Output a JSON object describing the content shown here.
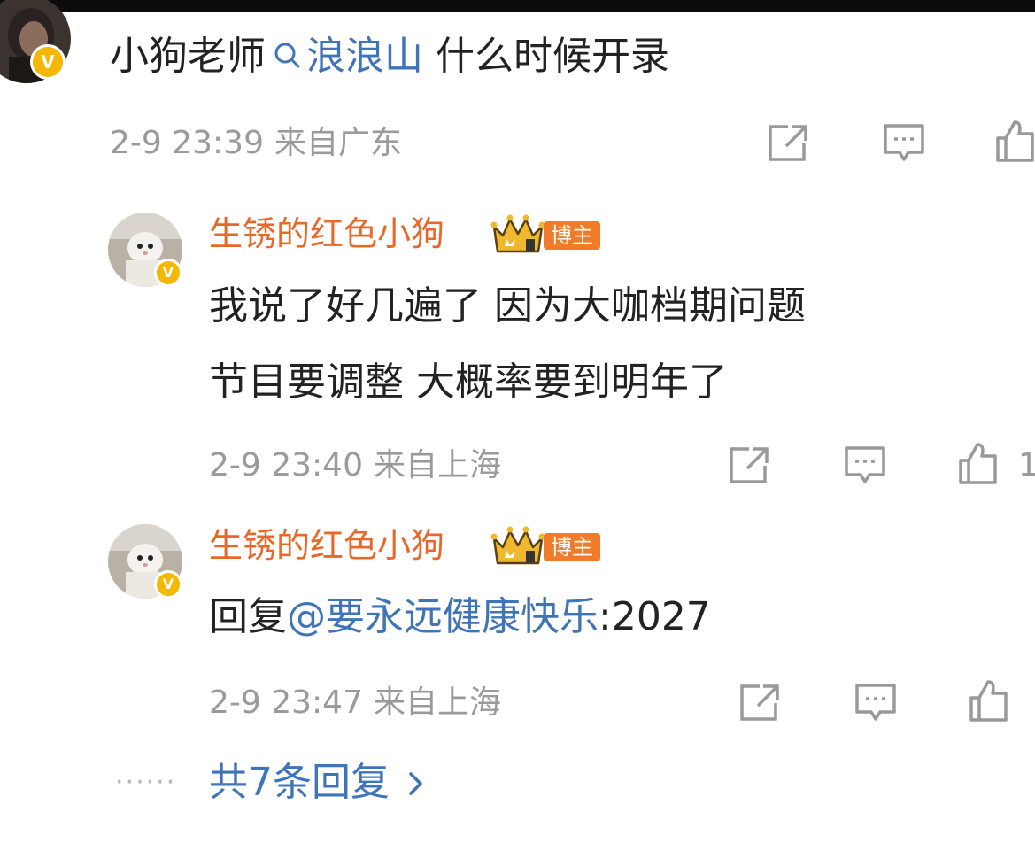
{
  "post": {
    "author_prefix": "小狗老师",
    "topic": "浪浪山",
    "text": " 什么时候开录",
    "time": "2-9 23:39",
    "location": "来自广东"
  },
  "replies": [
    {
      "username": "生锈的红色小狗",
      "role_badge": "博主",
      "lines": [
        "我说了好几遍了 因为大咖档期问题",
        "节目要调整 大概率要到明年了"
      ],
      "time": "2-9 23:40",
      "location": "来自上海",
      "like_count": "1"
    },
    {
      "username": "生锈的红色小狗",
      "role_badge": "博主",
      "reply_prefix": "回复",
      "mention": "@要永远健康快乐",
      "reply_suffix": ":2027",
      "time": "2-9 23:47",
      "location": "来自上海"
    }
  ],
  "more_replies": {
    "dots": "······",
    "label": "共7条回复"
  },
  "icons": {
    "share": "share-icon",
    "comment": "comment-icon",
    "like": "thumbs-up-icon",
    "verified": "verified-badge-icon",
    "crown": "crown-level-icon",
    "search": "search-icon",
    "chevron": "chevron-right-icon"
  },
  "colors": {
    "username": "#e8682a",
    "link": "#3f74b8",
    "meta": "#9a9a9a",
    "verified": "#f5b800",
    "bozhu_badge": "#f07b2b"
  },
  "badges": {
    "verified_letter": "V"
  }
}
